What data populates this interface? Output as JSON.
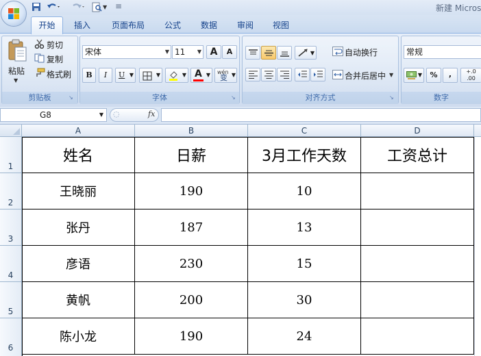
{
  "title_bar": {
    "document_title": "新建 Micros"
  },
  "quick_access": {
    "save_icon": "save-icon",
    "undo_icon": "undo-icon",
    "redo_icon": "redo-icon",
    "print_preview_icon": "print-preview-icon"
  },
  "tabs": [
    {
      "label": "开始",
      "active": true
    },
    {
      "label": "插入"
    },
    {
      "label": "页面布局"
    },
    {
      "label": "公式"
    },
    {
      "label": "数据"
    },
    {
      "label": "审阅"
    },
    {
      "label": "视图"
    }
  ],
  "ribbon": {
    "clipboard": {
      "label": "剪贴板",
      "paste": "粘贴",
      "cut": "剪切",
      "copy": "复制",
      "format_painter": "格式刷"
    },
    "font": {
      "label": "字体",
      "font_name": "宋体",
      "font_size": "11",
      "bold": "B",
      "italic": "I",
      "underline": "U",
      "grow": "A",
      "shrink": "A",
      "font_color_letter": "A",
      "wen": "wén",
      "wen_char": "变",
      "fill_color": "#ffff00",
      "font_color": "#ff0000"
    },
    "alignment": {
      "label": "对齐方式",
      "wrap_text": "自动换行",
      "merge_center": "合并后居中"
    },
    "number": {
      "label": "数字",
      "format": "常规",
      "percent": "%",
      "comma": ",",
      "increase_decimal": "+.0 .00"
    }
  },
  "formula_bar": {
    "name_box": "G8",
    "fx": "fx",
    "formula": ""
  },
  "sheet": {
    "columns": [
      "A",
      "B",
      "C",
      "D"
    ],
    "row_numbers": [
      "1",
      "2",
      "3",
      "4",
      "5",
      "6"
    ],
    "header": [
      "姓名",
      "日薪",
      "3月工作天数",
      "工资总计"
    ],
    "rows": [
      [
        "王晓丽",
        "190",
        "10",
        ""
      ],
      [
        "张丹",
        "187",
        "13",
        ""
      ],
      [
        "彦语",
        "230",
        "15",
        ""
      ],
      [
        "黄帆",
        "200",
        "30",
        ""
      ],
      [
        "陈小龙",
        "190",
        "24",
        ""
      ]
    ]
  }
}
